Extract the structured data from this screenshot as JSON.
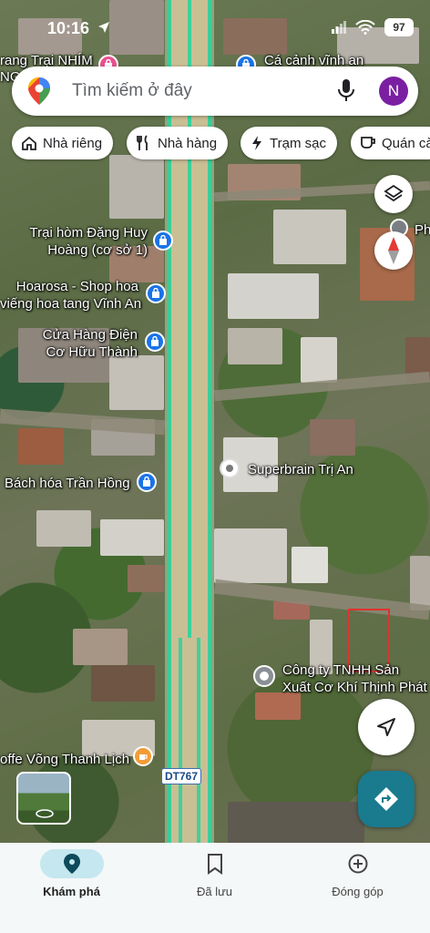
{
  "status_bar": {
    "time": "10:16",
    "battery": "97"
  },
  "search": {
    "placeholder": "Tìm kiếm ở đây",
    "avatar_letter": "N"
  },
  "chips": [
    {
      "label": "Nhà riêng",
      "icon": "home-icon"
    },
    {
      "label": "Nhà hàng",
      "icon": "restaurant-icon"
    },
    {
      "label": "Trạm sạc",
      "icon": "bolt-icon"
    },
    {
      "label": "Quán cà",
      "icon": "coffee-icon"
    }
  ],
  "places": {
    "top_left": "rang Trại NHÍM",
    "top_left_2": "NG",
    "top_right": "Cá cảnh vĩnh an",
    "dang_huy_1": "Trại hòm Đặng Huy",
    "dang_huy_2": "Hoàng (cơ sở 1)",
    "hoarosa_1": "Hoarosa - Shop hoa",
    "hoarosa_2": "viếng hoa tang Vĩnh An",
    "cua_hang_1": "Cửa Hàng Điện",
    "cua_hang_2": "Cơ Hữu Thành",
    "superbrain": "Superbrain Trị An",
    "bach_hoa": "Bách hóa Trần Hồng",
    "cong_ty_1": "Công ty TNHH Sản",
    "cong_ty_2": "Xuất Cơ Khí Thịnh Phát",
    "coffee": "offe Võng Thanh Lịch",
    "ph": "Ph",
    "route": "DT767"
  },
  "bottom_nav": [
    {
      "label": "Khám phá",
      "icon": "explore-pin-icon",
      "active": true
    },
    {
      "label": "Đã lưu",
      "icon": "bookmark-icon",
      "active": false
    },
    {
      "label": "Đóng góp",
      "icon": "add-circle-icon",
      "active": false
    }
  ],
  "colors": {
    "accent": "#1a73e8",
    "directions": "#1a7a8e",
    "avatar": "#7b1fa2",
    "road_lane": "#2fd39a"
  }
}
